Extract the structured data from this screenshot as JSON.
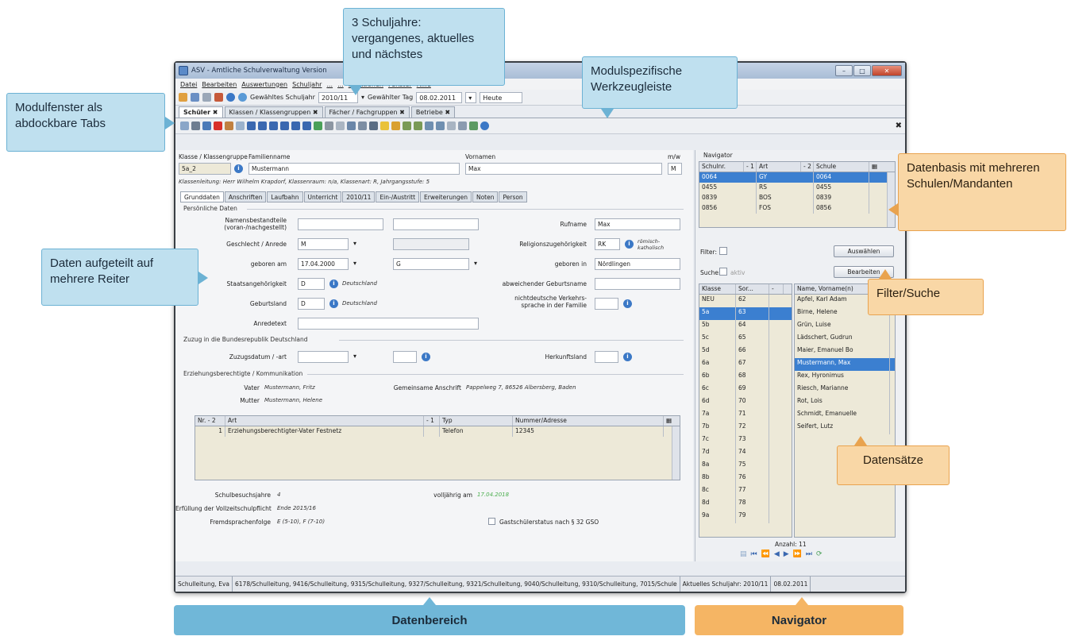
{
  "window": {
    "title": "ASV - Amtliche Schulverwaltung Version",
    "menu": [
      "Datei",
      "Bearbeiten",
      "Auswertungen",
      "Schuljahr",
      "...",
      "...",
      "Funktionen",
      "Fenster",
      "Hilfe"
    ],
    "schuljahr_label": "Gewähltes Schuljahr",
    "schuljahr_value": "2010/11",
    "tag_label": "Gewählter Tag",
    "tag_value": "08.02.2011",
    "heute": "Heute",
    "tabs": [
      "Schüler",
      "Klassen / Klassengruppen",
      "Fächer / Fachgruppen",
      "Betriebe"
    ]
  },
  "student": {
    "klasse_label": "Klasse / Klassengruppe",
    "klasse_value": "5a_2",
    "familienname_label": "Familienname",
    "familienname_value": "Mustermann",
    "vornamen_label": "Vornamen",
    "vornamen_value": "Max",
    "mw_label": "m/w",
    "mw_value": "M",
    "info_line": "Klassenleitung: Herr Wilhelm Krapdorf, Klassenraum: n/a, Klassenart: R, Jahrgangsstufe: 5",
    "subtabs": [
      "Grunddaten",
      "Anschriften",
      "Laufbahn",
      "Unterricht",
      "2010/11",
      "Ein-/Austritt",
      "Erweiterungen",
      "Noten",
      "Person"
    ],
    "group1": "Persönliche Daten",
    "namensbestandteile_label": "Namensbestandteile (voran-/nachgestellt)",
    "rufname_label": "Rufname",
    "rufname_value": "Max",
    "geschlecht_label": "Geschlecht / Anrede",
    "geschlecht_value": "M",
    "religion_label": "Religionszugehörigkeit",
    "religion_value": "RK",
    "religion_text": "römisch-katholisch",
    "geboren_am_label": "geboren am",
    "geboren_am_value": "17.04.2000",
    "geboren_am_extra": "G",
    "geboren_in_label": "geboren in",
    "geboren_in_value": "Nördlingen",
    "staat_label": "Staatsangehörigkeit",
    "staat_value": "D",
    "staat_text": "Deutschland",
    "abw_label": "abweichender Geburtsname",
    "geburtsland_label": "Geburtsland",
    "geburtsland_value": "D",
    "geburtsland_text": "Deutschland",
    "verkehrssprache_label": "nichtdeutsche Verkehrs-sprache in der Familie",
    "anredetext_label": "Anredetext",
    "group2": "Zuzug in die Bundesrepublik Deutschland",
    "zuzug_label": "Zuzugsdatum / -art",
    "herkunft_label": "Herkunftsland",
    "group3": "Erziehungsberechtigte / Kommunikation",
    "vater_label": "Vater",
    "vater_value": "Mustermann, Fritz",
    "mutter_label": "Mutter",
    "mutter_value": "Mustermann, Helene",
    "gemeinsam_label": "Gemeinsame Anschrift",
    "gemeinsam_value": "Pappelweg 7, 86526 Albersberg, Baden",
    "comm_headers": [
      "Nr. - 2",
      "Art",
      "- 1",
      "Typ",
      "Nummer/Adresse"
    ],
    "comm_rows": [
      [
        "1",
        "Erziehungsberechtigter-Vater Festnetz",
        "",
        "Telefon",
        "12345"
      ]
    ],
    "schulbesuch_label": "Schulbesuchsjahre",
    "schulbesuch_value": "4",
    "volljaehrig_label": "volljährig am",
    "volljaehrig_value": "17.04.2018",
    "vollzeit_label": "Erfüllung der Vollzeitschulpflicht",
    "vollzeit_value": "Ende 2015/16",
    "fremd_label": "Fremdsprachenfolge",
    "fremd_value": "E (5-10), F (7-10)",
    "gast_label": "Gastschülerstatus nach § 32 GSO"
  },
  "navigator": {
    "title": "Navigator",
    "db_headers": [
      "Schulnr.",
      "- 1",
      "Art",
      "- 2",
      "Schule"
    ],
    "db_rows": [
      [
        "0064",
        "GY",
        "0064"
      ],
      [
        "0455",
        "RS",
        "0455"
      ],
      [
        "0839",
        "BOS",
        "0839"
      ],
      [
        "0856",
        "FOS",
        "0856"
      ]
    ],
    "filter_label": "Filter:",
    "auswaehlen": "Auswählen",
    "suche_label": "Suche:",
    "aktiv": "aktiv",
    "bearbeiten": "Bearbeiten",
    "klasse_headers": [
      "Klasse",
      "Sor...",
      "-"
    ],
    "klassen": [
      [
        "NEU",
        "62"
      ],
      [
        "5a",
        "63"
      ],
      [
        "5b",
        "64"
      ],
      [
        "5c",
        "65"
      ],
      [
        "5d",
        "66"
      ],
      [
        "6a",
        "67"
      ],
      [
        "6b",
        "68"
      ],
      [
        "6c",
        "69"
      ],
      [
        "6d",
        "70"
      ],
      [
        "7a",
        "71"
      ],
      [
        "7b",
        "72"
      ],
      [
        "7c",
        "73"
      ],
      [
        "7d",
        "74"
      ],
      [
        "8a",
        "75"
      ],
      [
        "8b",
        "76"
      ],
      [
        "8c",
        "77"
      ],
      [
        "8d",
        "78"
      ],
      [
        "9a",
        "79"
      ]
    ],
    "names_header": "Name, Vorname(n)",
    "names": [
      "Apfel, Karl Adam",
      "Birne, Helene",
      "Grün, Luise",
      "Lädschert, Gudrun",
      "Maier, Emanuel Bo",
      "Mustermann, Max",
      "Rex, Hyronimus",
      "Riesch, Marianne",
      "Rot, Lois",
      "Schmidt, Emanuelle",
      "Seifert, Lutz"
    ],
    "anzahl": "Anzahl: 11"
  },
  "statusbar": [
    "Schulleitung, Eva",
    "6178/Schulleitung, 9416/Schulleitung, 9315/Schulleitung, 9327/Schulleitung, 9321/Schulleitung, 9040/Schulleitung, 9310/Schulleitung, 7015/Schule",
    "Aktuelles Schuljahr: 2010/11",
    "08.02.2011"
  ],
  "callouts": {
    "schuljahre": "3 Schuljahre: vergangenes, aktuelles und nächstes",
    "werkzeug": "Modulspezifische Werkzeugleiste",
    "modulfenster": "Modulfenster als abdockbare Tabs",
    "datenbasis": "Datenbasis mit mehreren Schulen/Mandanten",
    "reiter": "Daten aufgeteilt auf mehrere Reiter",
    "filter": "Filter/Suche",
    "datensaetze": "Datensätze"
  },
  "bottom": {
    "datenbereich": "Datenbereich",
    "navigator": "Navigator"
  },
  "colors": {
    "callout_blue": "#bfe0ef",
    "callout_orange": "#f9d7a6",
    "bar_blue": "#70b7d8",
    "bar_orange": "#f5b564",
    "selection": "#3b7fd0"
  }
}
